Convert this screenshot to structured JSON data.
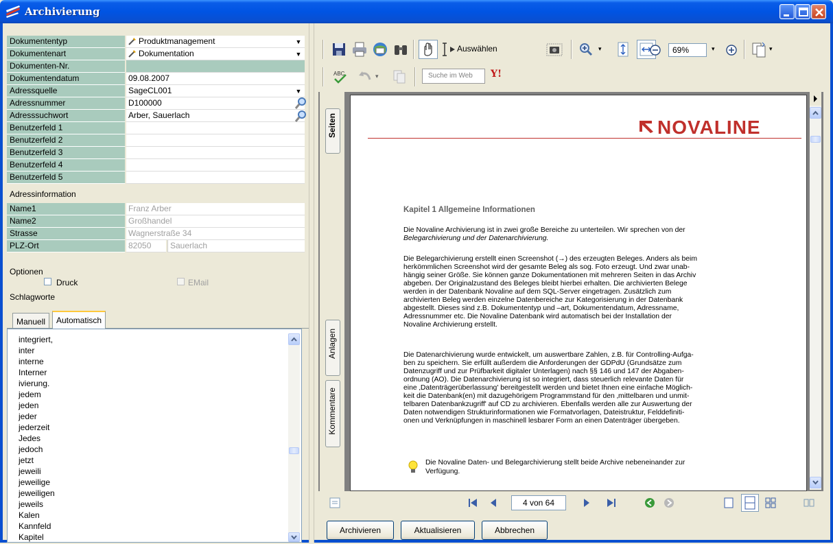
{
  "window": {
    "title": "Archivierung"
  },
  "fields": [
    {
      "label": "Dokumententyp",
      "value": "Produktmanagement"
    },
    {
      "label": "Dokumentenart",
      "value": "Dokumentation"
    },
    {
      "label": "Dokumenten-Nr.",
      "value": ""
    },
    {
      "label": "Dokumentendatum",
      "value": "09.08.2007"
    },
    {
      "label": "Adressquelle",
      "value": "SageCL001"
    },
    {
      "label": "Adressnummer",
      "value": "D100000"
    },
    {
      "label": "Adresssuchwort",
      "value": "Arber, Sauerlach"
    },
    {
      "label": "Benutzerfeld 1",
      "value": ""
    },
    {
      "label": "Benutzerfeld 2",
      "value": ""
    },
    {
      "label": "Benutzerfeld 3",
      "value": ""
    },
    {
      "label": "Benutzerfeld 4",
      "value": ""
    },
    {
      "label": "Benutzerfeld 5",
      "value": ""
    }
  ],
  "address": {
    "heading": "Adressinformation",
    "rows": [
      {
        "label": "Name1",
        "value": "Franz Arber"
      },
      {
        "label": "Name2",
        "value": "Großhandel"
      },
      {
        "label": "Strasse",
        "value": "Wagnerstraße 34"
      },
      {
        "label": "PLZ-Ort",
        "value": "82050",
        "value2": "Sauerlach"
      }
    ]
  },
  "options": {
    "heading": "Optionen",
    "druck": "Druck",
    "email": "EMail",
    "keywords_heading": "Schlagworte"
  },
  "tabs": {
    "manual": "Manuell",
    "auto": "Automatisch"
  },
  "keywords": [
    "integriert,",
    "inter",
    "interne",
    "Interner",
    "ivierung.",
    "jedem",
    "jeden",
    "jeder",
    "jederzeit",
    "Jedes",
    "jedoch",
    "jetzt",
    "jeweili",
    "jeweilige",
    "jeweiligen",
    "jeweils",
    "Kalen",
    "Kannfeld",
    "Kapitel"
  ],
  "toolbar": {
    "select_label": "Auswählen",
    "zoom": "69%",
    "search_placeholder": "Suche im Web"
  },
  "side_tabs": {
    "pages": "Seiten",
    "attachments": "Anlagen",
    "comments": "Kommentare"
  },
  "document": {
    "logo": "NOVALINE",
    "heading": "Kapitel 1 Allgemeine Informationen",
    "p1_l1": "Die Novaline Archivierung ist in zwei große Bereiche zu unterteilen. Wir sprechen von der",
    "p1_l2": "Belegarchivierung und der Datenarchivierung.",
    "p2": [
      "Die Belegarchivierung erstellt einen Screenshot (→) des erzeugten Beleges. Anders als beim",
      "herkömmlichen Screenshot wird der gesamte Beleg als sog. Foto erzeugt. Und zwar unab-",
      "hängig seiner Größe. Sie können ganze Dokumentationen mit mehreren Seiten in das Archiv",
      "abgeben. Der Originalzustand des Beleges bleibt hierbei erhalten. Die archivierten Belege",
      "werden in der Datenbank Novaline auf dem SQL-Server eingetragen. Zusätzlich zum",
      "archivierten Beleg werden einzelne Datenbereiche zur Kategorisierung in der Datenbank",
      "abgestellt. Dieses sind z.B. Dokumententyp und –art, Dokumentendatum, Adressname,",
      "Adressnummer etc. Die Novaline Datenbank wird automatisch bei der Installation der",
      "Novaline Archivierung erstellt."
    ],
    "p3": [
      "Die Datenarchivierung wurde entwickelt, um auswertbare Zahlen, z.B. für Controlling-Aufga-",
      "ben zu speichern. Sie erfüllt außerdem die Anforderungen der GDPdU (Grundsätze zum",
      "Datenzugriff und zur Prüfbarkeit digitaler Unterlagen) nach §§ 146 und 147 der Abgaben-",
      "ordnung (AO). Die Datenarchivierung ist so integriert, dass steuerlich relevante Daten für",
      "eine ‚Datenträgerüberlassung' bereitgestellt werden und bietet Ihnen eine einfache Möglich-",
      "keit die Datenbank(en) mit dazugehörigem Programmstand für den ‚mittelbaren und unmit-",
      "telbaren Datenbankzugriff' auf CD zu archivieren. Ebenfalls werden alle zur Auswertung der",
      "Daten notwendigen Strukturinformationen wie Formatvorlagen, Dateistruktur, Felddefiniti-",
      "onen und Verknüpfungen in maschinell lesbarer Form an einen Datenträger übergeben."
    ],
    "tip_l1": "Die Novaline Daten- und Belegarchivierung stellt beide Archive nebeneinander zur",
    "tip_l2": "Verfügung."
  },
  "nav": {
    "page": "4 von 64"
  },
  "buttons": {
    "archive": "Archivieren",
    "refresh": "Aktualisieren",
    "cancel": "Abbrechen"
  },
  "colors": {
    "label_bg": "#a9cbbd",
    "titlebar": "#0054e3",
    "brand": "#c0302c"
  }
}
